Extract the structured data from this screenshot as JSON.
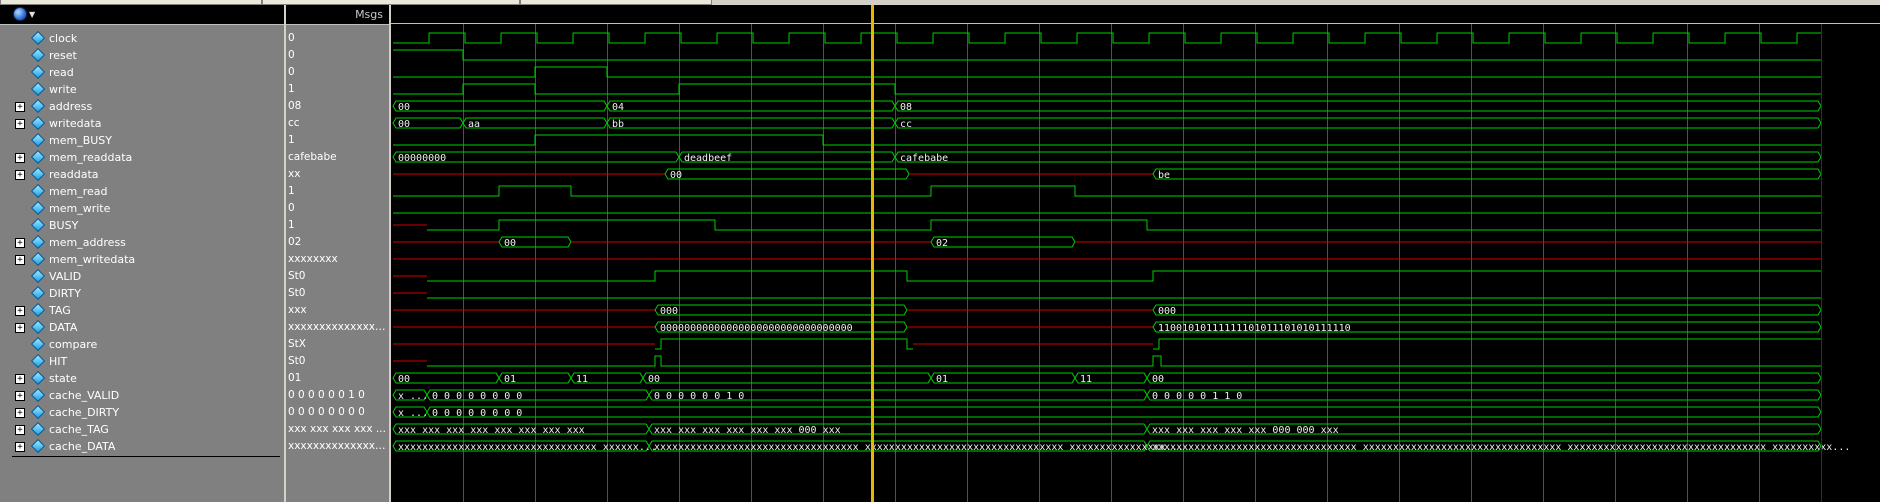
{
  "header": {
    "msgs_label": "Msgs"
  },
  "colors": {
    "signal": "#00d000",
    "undefined": "#d00000",
    "cursor": "#e8b800",
    "grid": "#505050",
    "value_text": "#f0f0f0"
  },
  "icons": {
    "toolbar": "globe-icon",
    "expand": "plus-expander-icon",
    "signal": "diamond-signal-icon"
  },
  "cursor": {
    "time_fraction": 0.3233
  },
  "signals": [
    {
      "name": "clock",
      "value": "0",
      "bus": false
    },
    {
      "name": "reset",
      "value": "0",
      "bus": false
    },
    {
      "name": "read",
      "value": "0",
      "bus": false
    },
    {
      "name": "write",
      "value": "1",
      "bus": false
    },
    {
      "name": "address",
      "value": "08",
      "bus": true
    },
    {
      "name": "writedata",
      "value": "cc",
      "bus": true
    },
    {
      "name": "mem_BUSY",
      "value": "1",
      "bus": false
    },
    {
      "name": "mem_readdata",
      "value": "cafebabe",
      "bus": true
    },
    {
      "name": "readdata",
      "value": "xx",
      "bus": true
    },
    {
      "name": "mem_read",
      "value": "1",
      "bus": false
    },
    {
      "name": "mem_write",
      "value": "0",
      "bus": false
    },
    {
      "name": "BUSY",
      "value": "1",
      "bus": false
    },
    {
      "name": "mem_address",
      "value": "02",
      "bus": true
    },
    {
      "name": "mem_writedata",
      "value": "xxxxxxxx",
      "bus": true
    },
    {
      "name": "VALID",
      "value": "St0",
      "bus": false
    },
    {
      "name": "DIRTY",
      "value": "St0",
      "bus": false
    },
    {
      "name": "TAG",
      "value": "xxx",
      "bus": true
    },
    {
      "name": "DATA",
      "value": "xxxxxxxxxxxxxxxxx...",
      "bus": true
    },
    {
      "name": "compare",
      "value": "StX",
      "bus": false
    },
    {
      "name": "HIT",
      "value": "St0",
      "bus": false
    },
    {
      "name": "state",
      "value": "01",
      "bus": true
    },
    {
      "name": "cache_VALID",
      "value": "0 0 0 0 0 0 1 0",
      "bus": true
    },
    {
      "name": "cache_DIRTY",
      "value": "0 0 0 0 0 0 0 0",
      "bus": true
    },
    {
      "name": "cache_TAG",
      "value": "xxx xxx xxx xxx ...",
      "bus": true
    },
    {
      "name": "cache_DATA",
      "value": "xxxxxxxxxxxxxxx...",
      "bus": true
    }
  ],
  "bus_labels": {
    "address": [
      "00",
      "04",
      "08"
    ],
    "writedata": [
      "00",
      "aa",
      "bb",
      "cc"
    ],
    "mem_readdata": [
      "00000000",
      "deadbeef",
      "cafebabe"
    ],
    "readdata": [
      "00",
      "be"
    ],
    "mem_address": [
      "00",
      "02"
    ],
    "TAG": [
      "000",
      "000"
    ],
    "DATA": [
      "00000000000000000000000000000000",
      "11001010111111101011101010111110"
    ],
    "state": [
      "00",
      "01",
      "11",
      "00",
      "01",
      "11",
      "00"
    ],
    "cache_VALID": [
      "x ...",
      "0 0 0 0 0 0 0 0",
      "0 0 0 0 0 0 1 0",
      "0 0 0 0 0 1 1 0"
    ],
    "cache_DIRTY": [
      "x ...",
      "0 0 0 0 0 0 0 0"
    ],
    "cache_TAG": [
      "xxx xxx xxx xxx xxx xxx xxx xxx",
      "xxx xxx xxx xxx xxx xxx 000 xxx",
      "xxx xxx xxx xxx xxx 000 000 xxx"
    ],
    "cache_DATA": [
      "xxxxxxxxxxxxxxxxxxxxxxxxxxxxxxxxx xxxxxx...",
      "xxxxxxxxxxxxxxxxxxxxxxxxxxxxxxxxxx xxxxxxxxxxxxxxxxxxxxxxxxxxxxxxxxx xxxxxxxxxxxxxxxx...",
      "xxxxxxxxxxxxxxxxxxxxxxxxxxxxxxxxxx xxxxxxxxxxxxxxxxxxxxxxxxxxxxxxxxx xxxxxxxxxxxxxxxxxxxxxxxxxxxxxxxxx xxxxxxxxxx..."
    ]
  }
}
